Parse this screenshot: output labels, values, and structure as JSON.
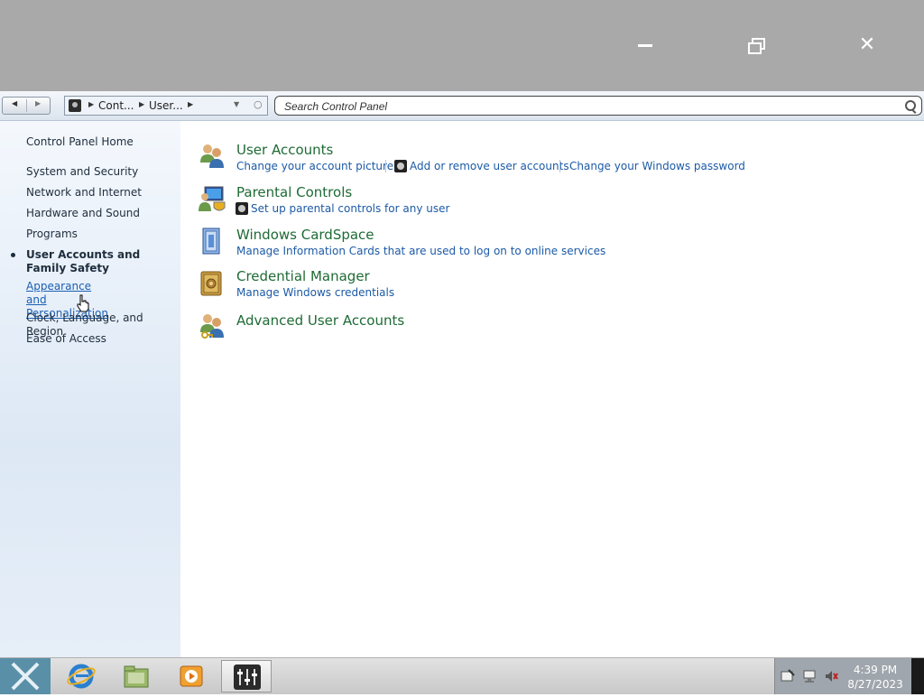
{
  "navbar": {
    "breadcrumbs": [
      "Cont...",
      "User..."
    ],
    "search_placeholder": "Search Control Panel"
  },
  "sidebar": {
    "home": "Control Panel Home",
    "items": [
      "System and Security",
      "Network and Internet",
      "Hardware and Sound",
      "Programs",
      "User Accounts and Family Safety",
      "Appearance and Personalization",
      "Clock, Language, and Region",
      "Ease of Access"
    ],
    "current_index": 4,
    "hover_index": 5
  },
  "categories": [
    {
      "title": "User Accounts",
      "icon": "users-icon",
      "tasks": [
        "Change your account picture",
        "Add or remove user accounts",
        "Change your Windows password"
      ]
    },
    {
      "title": "Parental Controls",
      "icon": "parental-controls-icon",
      "tasks": [
        "Set up parental controls for any user"
      ]
    },
    {
      "title": "Windows CardSpace",
      "icon": "cardspace-icon",
      "tasks": [
        "Manage Information Cards that are used to log on to online services"
      ]
    },
    {
      "title": "Credential Manager",
      "icon": "vault-icon",
      "tasks": [
        "Manage Windows credentials"
      ]
    },
    {
      "title": "Advanced User Accounts",
      "icon": "users-key-icon",
      "tasks": []
    }
  ],
  "taskbar": {
    "apps": [
      "internet-explorer-icon",
      "file-explorer-icon",
      "media-player-icon",
      "control-panel-icon"
    ],
    "tray_icons": [
      "action-center-icon",
      "network-icon",
      "volume-muted-icon"
    ],
    "time": "4:39 PM",
    "date": "8/27/2023"
  },
  "colors": {
    "title_bar": "#a9a9a9",
    "category_title": "#1e6b35",
    "task_link": "#1c5aa6"
  }
}
